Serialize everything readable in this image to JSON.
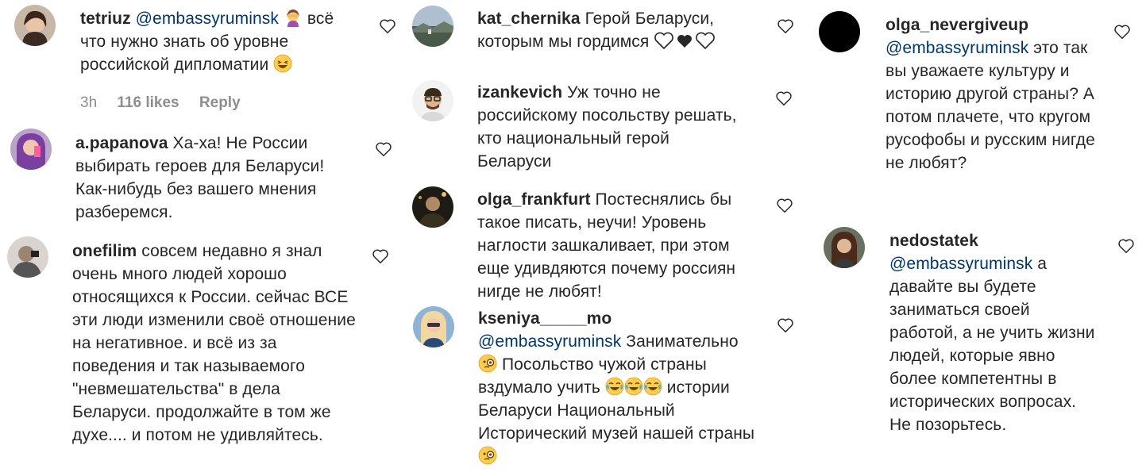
{
  "comments": [
    {
      "username": "tetriuz",
      "mention": "@embassyruminsk",
      "text_before": "",
      "text": "всё что нужно знать об уровне российской дипломатии",
      "time": "3h",
      "likes": "116 likes",
      "reply": "Reply",
      "emoji": [
        "woman-facepalming",
        "laughing-face"
      ]
    },
    {
      "username": "a.papanova",
      "text": "Ха-ха! Не России выбирать героев для Беларуси! Как-нибудь без вашего мнения разберемся."
    },
    {
      "username": "onefilim",
      "text": "совсем недавно я знал очень много людей хорошо относящихся к России. сейчас ВСЕ эти люди изменили своё отношение на негативное. и всё из за поведения и так называемого \"невмешательства\" в дела Беларуси. продолжайте в том же духе.... и потом не удивляйтесь."
    },
    {
      "username": "kat_chernika",
      "text": "Герой Беларуси, которым мы гордимся",
      "emoji": [
        "white-heart",
        "black-heart",
        "white-heart"
      ]
    },
    {
      "username": "izankevich",
      "text": "Уж точно не российскому посольству решать, кто национальный герой Беларуси"
    },
    {
      "username": "olga_frankfurt",
      "text": "Постеснялись бы такое писать, неучи! Уровень наглости зашкаливает, при этом еще удивдяются почему россиян нигде не любят!"
    },
    {
      "username": "kseniya_____mo",
      "mention": "@embassyruminsk",
      "text": "Занимательно",
      "text2": "Посольство чужой страны вздумало учить",
      "text3": "истории Беларуси Национальный Исторический музей нашей страны",
      "emoji": [
        "face-with-monocle",
        "tears-of-joy",
        "tears-of-joy",
        "tears-of-joy",
        "face-with-monocle"
      ]
    },
    {
      "username": "olga_nevergiveup",
      "mention": "@embassyruminsk",
      "text": "это так вы уважаете культуру и историю другой страны? А потом плачете, что кругом русофобы и русским нигде не любят?"
    },
    {
      "username": "nedostatek",
      "mention": "@embassyruminsk",
      "text": "а давайте вы будете заниматься своей работой, а не учить жизни людей, которые явно более компетентны в исторических вопросах. Не позорьтесь."
    }
  ],
  "colors": {
    "text": "#262626",
    "muted": "#8e8e8e",
    "mention": "#00376b",
    "background": "#ffffff"
  },
  "icons": {
    "like": "heart-outline-icon"
  }
}
